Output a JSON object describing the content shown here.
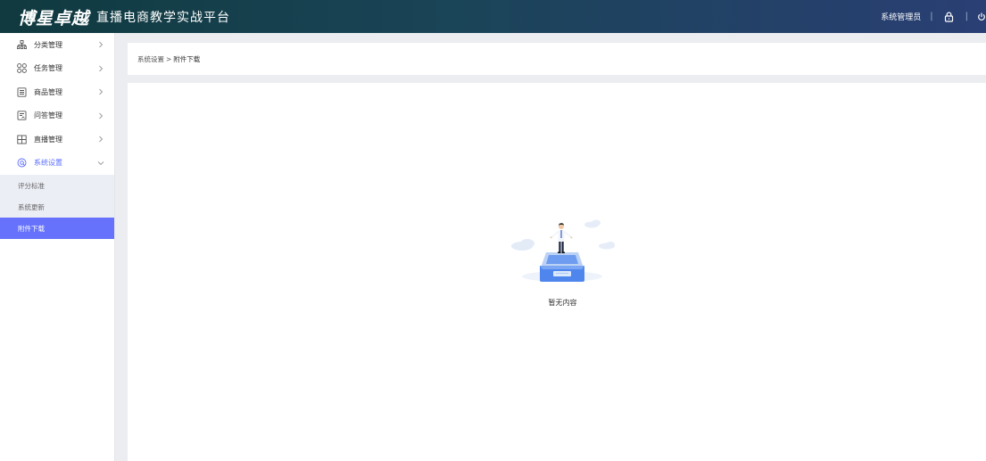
{
  "header": {
    "logo": "博星卓越",
    "title": "直播电商教学实战平台",
    "user": "系统管理员",
    "separator": "|",
    "colors": {
      "gradient_start": "#103a3f",
      "gradient_end": "#2a3f74"
    }
  },
  "sidebar": {
    "items": [
      {
        "label": "分类管理",
        "icon": "category-tree-icon"
      },
      {
        "label": "任务管理",
        "icon": "task-grid-icon"
      },
      {
        "label": "商品管理",
        "icon": "product-list-icon"
      },
      {
        "label": "问答管理",
        "icon": "qa-document-icon"
      },
      {
        "label": "直播管理",
        "icon": "live-grid-icon"
      },
      {
        "label": "系统设置",
        "icon": "settings-icon",
        "expanded": true
      }
    ],
    "submenu": [
      {
        "label": "评分标准"
      },
      {
        "label": "系统更新"
      },
      {
        "label": "附件下载",
        "selected": true
      }
    ],
    "colors": {
      "active": "#5b6cff",
      "selected_bg": "#6672fb"
    }
  },
  "breadcrumb": {
    "parent": "系统设置",
    "separator": ">",
    "current": "附件下载"
  },
  "empty_state": {
    "text": "暂无内容",
    "icon": "empty-box-illustration"
  }
}
